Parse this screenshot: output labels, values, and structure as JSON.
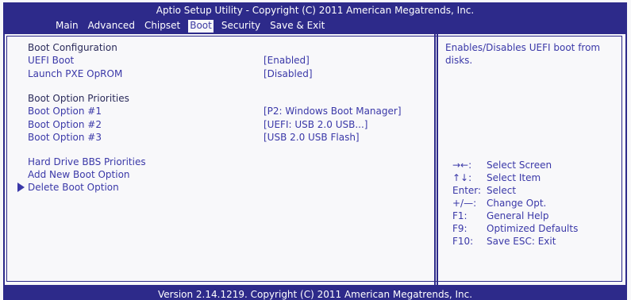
{
  "header": {
    "title": "Aptio Setup Utility - Copyright (C) 2011 American Megatrends, Inc.",
    "tabs": [
      "Main",
      "Advanced",
      "Chipset",
      "Boot",
      "Security",
      "Save & Exit"
    ],
    "active_tab": "Boot"
  },
  "boot": {
    "config_heading": "Boot Configuration",
    "uefi_boot": {
      "label": "UEFI Boot",
      "value": "[Enabled]"
    },
    "launch_pxe": {
      "label": "Launch PXE OpROM",
      "value": "[Disabled]"
    },
    "priorities_heading": "Boot Option Priorities",
    "options": [
      {
        "label": "Boot Option #1",
        "value": "[P2:  Windows Boot Manager]"
      },
      {
        "label": "Boot Option #2",
        "value": "[UEFI: USB 2.0 USB...]"
      },
      {
        "label": "Boot Option #3",
        "value": "[USB 2.0 USB Flash]"
      }
    ],
    "hdd_bbs": "Hard Drive BBS Priorities",
    "add_option": "Add New Boot Option",
    "delete_option": "Delete Boot Option"
  },
  "help": {
    "text": "Enables/Disables UEFI boot from disks."
  },
  "keys": [
    {
      "key": "→←:",
      "desc": "Select Screen"
    },
    {
      "key": "↑↓:",
      "desc": "Select Item"
    },
    {
      "key": "Enter:",
      "desc": "Select"
    },
    {
      "key": "+/—:",
      "desc": "Change Opt."
    },
    {
      "key": "F1:",
      "desc": "General Help"
    },
    {
      "key": "F9:",
      "desc": "Optimized Defaults"
    },
    {
      "key": "F10:",
      "desc": "Save   ESC: Exit"
    }
  ],
  "footer": "Version 2.14.1219. Copyright (C) 2011 American Megatrends, Inc."
}
